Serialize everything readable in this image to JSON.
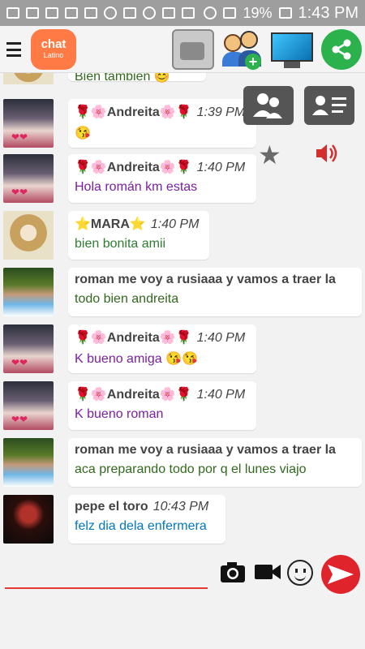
{
  "statusbar": {
    "battery": "19%",
    "time": "1:43 PM"
  },
  "app": {
    "logo_text": "chat",
    "logo_sub": "Latino"
  },
  "partial_message": {
    "text": "Bien también 😊"
  },
  "messages": [
    {
      "name": "🌹🌸Andreita🌸🌹",
      "time": "1:39 PM",
      "text": "😘"
    },
    {
      "name": "🌹🌸Andreita🌸🌹",
      "time": "1:40 PM",
      "text": "Hola román km estas"
    },
    {
      "name": "⭐MARA⭐",
      "time": "1:40 PM",
      "text": "bien bonita amii"
    },
    {
      "name": "roman me voy a rusiaaa y vamos a traer la",
      "time": "",
      "text": "todo bien andreita"
    },
    {
      "name": "🌹🌸Andreita🌸🌹",
      "time": "1:40 PM",
      "text": "K bueno amiga 😘😘"
    },
    {
      "name": "🌹🌸Andreita🌸🌹",
      "time": "1:40 PM",
      "text": "K bueno roman"
    },
    {
      "name": "roman me voy a rusiaaa y vamos a traer la",
      "time": "",
      "text": "aca preparando todo por q el lunes viajo"
    },
    {
      "name": "pepe el toro",
      "time": "10:43 PM",
      "text": "felz dia dela enfermera"
    }
  ],
  "input": {
    "placeholder": "",
    "value": ""
  },
  "icons": {
    "menu": "menu-icon",
    "radio": "radio-icon",
    "contacts": "add-contact-icon",
    "tv": "tv-icon",
    "share": "share-icon",
    "group": "group-icon",
    "card": "contact-card-icon",
    "star": "star-icon",
    "speaker": "speaker-icon",
    "camera": "camera-icon",
    "video": "video-icon",
    "emoji": "emoji-icon",
    "send": "send-icon"
  },
  "colors": {
    "accent": "#e0242c",
    "share": "#2bb24c",
    "statusbar": "#9e9e9e",
    "logo": "#ff7a45"
  }
}
